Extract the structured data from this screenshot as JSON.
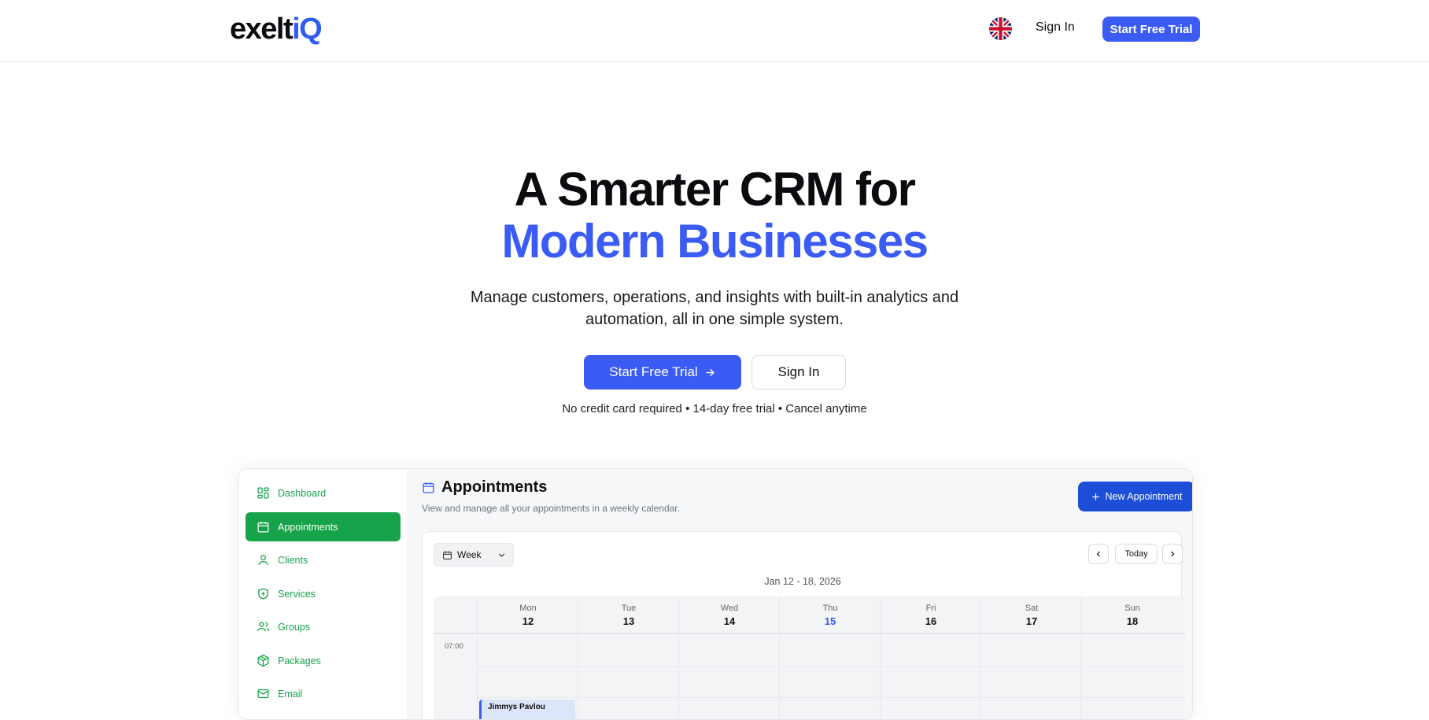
{
  "header": {
    "logo_main": "exelt",
    "logo_accent": "iQ",
    "signin_label": "Sign In",
    "trial_label": "Start Free Trial"
  },
  "hero": {
    "title_line1": "A Smarter CRM for",
    "title_line2": "Modern Businesses",
    "subtitle": "Manage customers, operations, and insights with built-in analytics and automation, all in one simple system.",
    "cta_primary": "Start Free Trial",
    "cta_secondary": "Sign In",
    "fineprint": "No credit card required • 14-day free trial • Cancel anytime"
  },
  "app": {
    "sidebar": {
      "items": [
        {
          "label": "Dashboard",
          "icon": "dashboard-icon"
        },
        {
          "label": "Appointments",
          "icon": "calendar-icon",
          "active": true
        },
        {
          "label": "Clients",
          "icon": "user-icon"
        },
        {
          "label": "Services",
          "icon": "shield-plus-icon"
        },
        {
          "label": "Groups",
          "icon": "users-icon"
        },
        {
          "label": "Packages",
          "icon": "package-icon"
        },
        {
          "label": "Email",
          "icon": "mail-icon"
        }
      ]
    },
    "main": {
      "title": "Appointments",
      "subtitle": "View and manage all your appointments in a weekly calendar.",
      "new_button": "New Appointment",
      "view_select": "Week",
      "today_button": "Today",
      "date_range": "Jan 12 - 18, 2026",
      "days": [
        {
          "name": "Mon",
          "num": "12"
        },
        {
          "name": "Tue",
          "num": "13"
        },
        {
          "name": "Wed",
          "num": "14"
        },
        {
          "name": "Thu",
          "num": "15",
          "today": true
        },
        {
          "name": "Fri",
          "num": "16"
        },
        {
          "name": "Sat",
          "num": "17"
        },
        {
          "name": "Sun",
          "num": "18"
        }
      ],
      "time_first": "07:00",
      "appointment_name": "Jimmys Pavlou"
    }
  },
  "colors": {
    "brand": "#3b5bf5",
    "sidebar_green": "#16a34a",
    "today": "#2f5bf0"
  }
}
